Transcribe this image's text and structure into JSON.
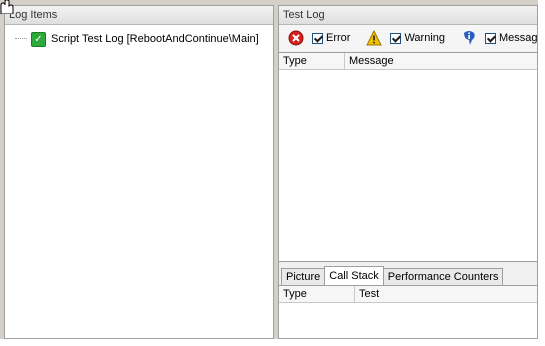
{
  "log_items": {
    "title": "Log Items",
    "tree": [
      {
        "label": "Script Test Log [RebootAndContinue\\Main]",
        "status": "passed"
      }
    ]
  },
  "test_log": {
    "title": "Test Log",
    "filters": [
      {
        "label": "Error",
        "checked": true,
        "icon": "error-icon"
      },
      {
        "label": "Warning",
        "checked": true,
        "icon": "warning-icon"
      },
      {
        "label": "Messages",
        "checked": true,
        "icon": "info-icon"
      }
    ],
    "columns": [
      "Type",
      "Message"
    ],
    "tabs": [
      "Picture",
      "Call Stack",
      "Performance Counters"
    ],
    "active_tab": "Call Stack",
    "bottom_columns": [
      "Type",
      "Test"
    ]
  },
  "colors": {
    "error_red": "#d62020",
    "warning_yellow": "#f2c200",
    "info_blue": "#2a5fc1",
    "pass_green": "#2eaa3a"
  }
}
